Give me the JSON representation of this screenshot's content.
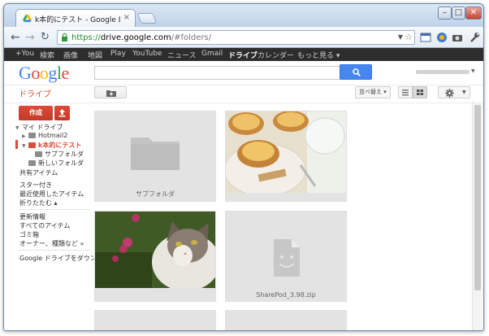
{
  "browser": {
    "tab_title": "k本的にテスト - Google D",
    "url_scheme": "https://",
    "url_host": "drive.google.com",
    "url_path": "/#folders/",
    "controls": {
      "minimize": "–",
      "maximize": "□",
      "close": "✕"
    }
  },
  "google_bar": {
    "items": [
      "+You",
      "検索",
      "画像",
      "地図",
      "Play",
      "YouTube",
      "ニュース",
      "Gmail",
      "ドライブ",
      "カレンダー",
      "もっと見る ▾"
    ],
    "active": "ドライブ"
  },
  "header": {
    "logo": "Google",
    "search_placeholder": ""
  },
  "toolbar": {
    "drive_label": "ドライブ",
    "sort_label": "並べ替え ▾"
  },
  "sidebar": {
    "create_label": "作成",
    "tree": [
      {
        "label": "マイ ドライブ",
        "indent": 0
      },
      {
        "label": "Hotmail2",
        "indent": 1
      },
      {
        "label": "k本的にテスト",
        "indent": 1,
        "active": true
      },
      {
        "label": "サブフォルダ",
        "indent": 2
      },
      {
        "label": "新しいフォルダ",
        "indent": 1
      }
    ],
    "links": [
      "共有アイテム",
      "スター付き",
      "最近使用したアイテム",
      "折りたたむ ▴",
      "更新情報",
      "すべてのアイテム",
      "ゴミ箱",
      "オーナー、種類など »",
      "Google ドライブをダウンロ"
    ]
  },
  "files": [
    {
      "name": "サブフォルダ",
      "type": "folder"
    },
    {
      "name": "",
      "type": "image-tarts"
    },
    {
      "name": "",
      "type": "image-cat"
    },
    {
      "name": "SharePod_3.98.zip",
      "type": "zip"
    }
  ],
  "colors": {
    "accent_red": "#dd4b39",
    "search_blue": "#4787ed",
    "gbar_bg": "#2d2d2d"
  }
}
